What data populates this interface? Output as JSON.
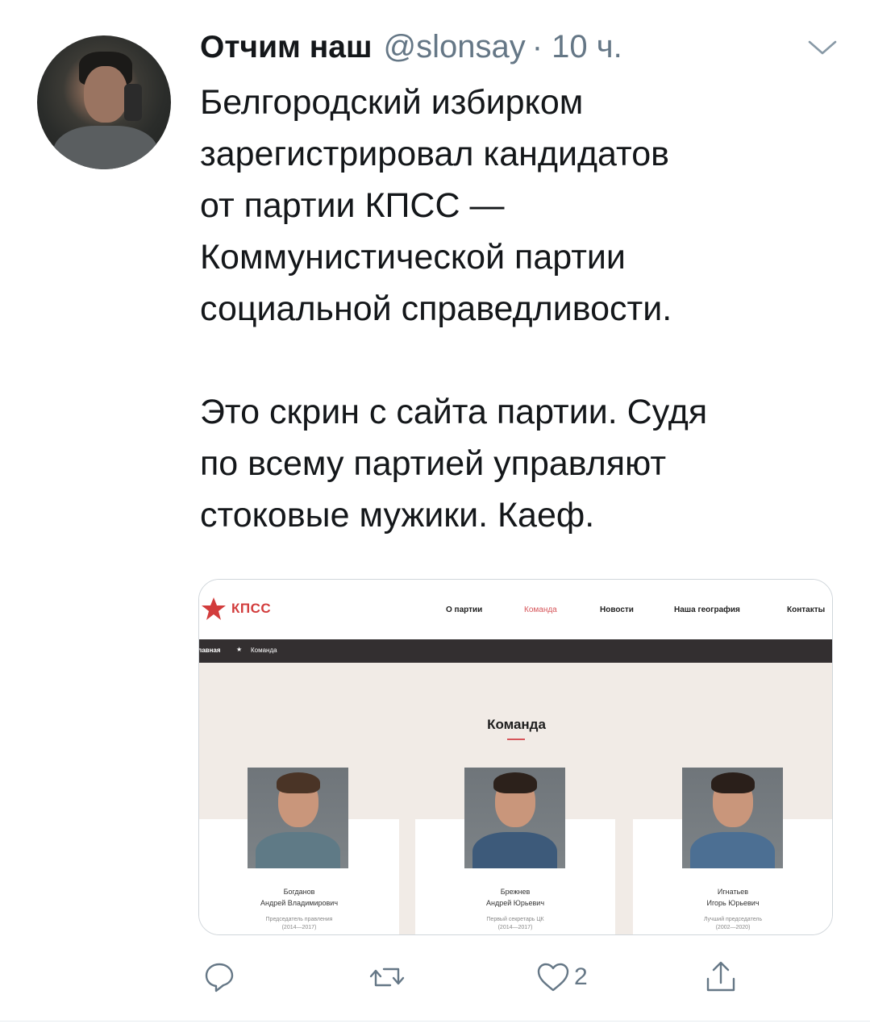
{
  "tweet": {
    "display_name": "Отчим наш",
    "handle": "@slonsay",
    "time": "· 10 ч.",
    "text": "Белгородский избирком\nзарегистрировал кандидатов\nот партии КПСС —\nКоммунистической партии\nсоциальной справедливости.\n\nЭто скрин с сайта партии. Судя\nпо всему партией управляют\nстоковые мужики. Каеф.",
    "likes_count": "2"
  },
  "screenshot": {
    "logo_text": "КПСС",
    "nav": [
      "О партии",
      "Команда",
      "Новости",
      "Наша география",
      "Контакты"
    ],
    "breadcrumb": [
      "Главная",
      "Команда"
    ],
    "breadcrumb_separator": "★",
    "section_title": "Команда",
    "members": [
      {
        "surname": "Богданов",
        "name": "Андрей Владимирович",
        "role": "Председатель правления",
        "years": "(2014—2017)"
      },
      {
        "surname": "Брежнев",
        "name": "Андрей Юрьевич",
        "role": "Первый секретарь ЦК",
        "years": "(2014—2017)"
      },
      {
        "surname": "Игнатьев",
        "name": "Игорь Юрьевич",
        "role": "Лучший председатель",
        "years": "(2002—2020)"
      }
    ]
  },
  "icons": {
    "menu": "chevron-down-icon",
    "reply": "reply-icon",
    "retweet": "retweet-icon",
    "like": "heart-icon",
    "share": "share-icon",
    "logo": "red-star-icon"
  },
  "colors": {
    "text": "#14171a",
    "muted": "#657786",
    "kpss_red": "#d23c3c",
    "crumb_bar": "#332f30",
    "hero_bg": "#f1ebe6"
  }
}
